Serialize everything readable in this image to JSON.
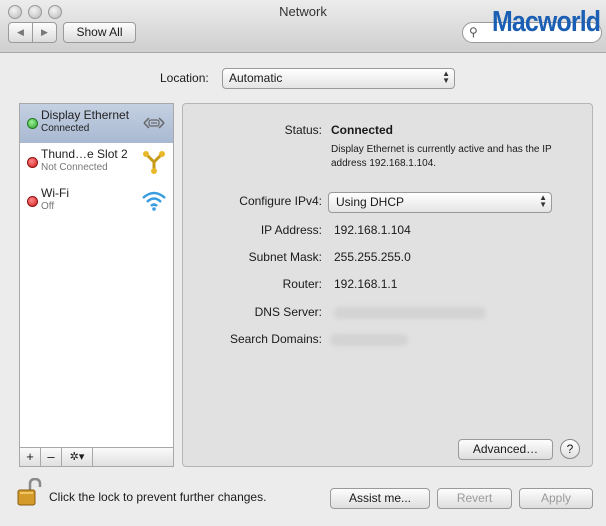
{
  "window": {
    "title": "Network"
  },
  "toolbar": {
    "back": "◀",
    "forward": "▶",
    "show_all": "Show All",
    "search_placeholder": "",
    "logo": "Macworld"
  },
  "location": {
    "label": "Location:",
    "value": "Automatic"
  },
  "services": [
    {
      "name": "Display Ethernet",
      "status": "Connected",
      "state": "connected",
      "icon": "ethernet-icon",
      "selected": true
    },
    {
      "name": "Thund…e Slot 2",
      "status": "Not Connected",
      "state": "disconnected",
      "icon": "firewire-icon",
      "selected": false
    },
    {
      "name": "Wi-Fi",
      "status": "Off",
      "state": "disconnected",
      "icon": "wifi-icon",
      "selected": false
    }
  ],
  "sidebar_bar": {
    "add": "+",
    "remove": "–",
    "gear": "✲▾"
  },
  "detail": {
    "status_label": "Status:",
    "status_value": "Connected",
    "status_desc": "Display Ethernet is currently active and has the IP address 192.168.1.104.",
    "configure_label": "Configure IPv4:",
    "configure_value": "Using DHCP",
    "ip_label": "IP Address:",
    "ip_value": "192.168.1.104",
    "subnet_label": "Subnet Mask:",
    "subnet_value": "255.255.255.0",
    "router_label": "Router:",
    "router_value": "192.168.1.1",
    "dns_label": "DNS Server:",
    "search_label": "Search Domains:",
    "advanced": "Advanced…",
    "help": "?"
  },
  "footer": {
    "lock_text": "Click the lock to prevent further changes.",
    "assist": "Assist me...",
    "revert": "Revert",
    "apply": "Apply"
  },
  "colors": {
    "connected": "#2ea02b",
    "disconnected": "#d11d1d",
    "selection": "#b3c1d8",
    "logo": "#1a5fb4"
  }
}
